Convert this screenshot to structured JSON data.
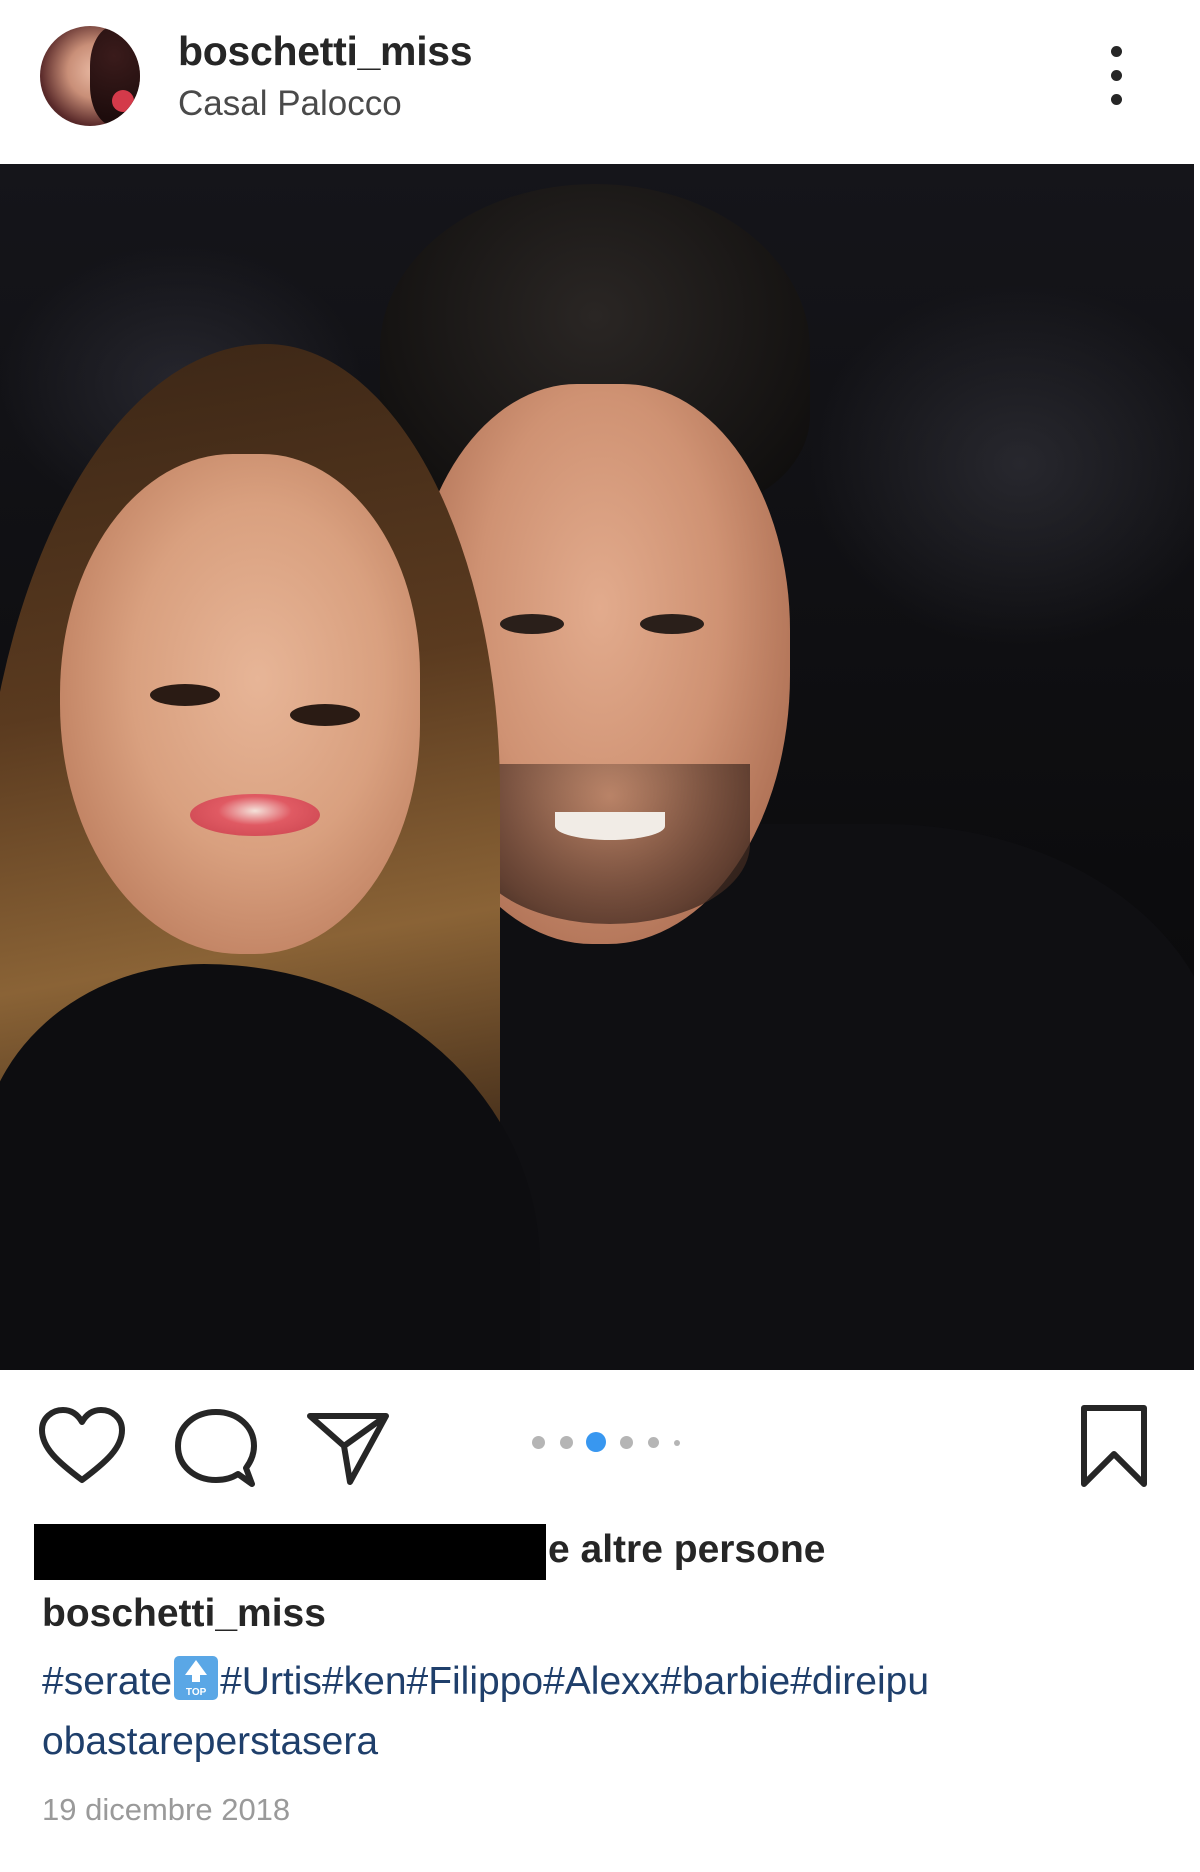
{
  "post": {
    "username": "boschetti_miss",
    "location": "Casal Palocco",
    "likes_suffix": "e altre persone",
    "caption_username": "boschetti_miss",
    "hashtags_part1": "#serate",
    "hashtag_emoji_label": "TOP",
    "hashtags_part2": "#Urtis#ken#Filippo#Alexx#barbie#direipu obastareperstasera",
    "date": "19 dicembre 2018"
  },
  "carousel": {
    "total_visible_dots": 6,
    "active_index": 2
  },
  "icons": {
    "more": "more-vertical-icon",
    "like": "heart-icon",
    "comment": "comment-icon",
    "share": "send-icon",
    "save": "bookmark-icon"
  },
  "colors": {
    "text": "#262626",
    "hashtag": "#1f3f6b",
    "date": "#9a9a9a",
    "carousel_active": "#3897f0",
    "carousel_inactive": "#b5b5b5",
    "top_emoji": "#5aa7e6"
  }
}
